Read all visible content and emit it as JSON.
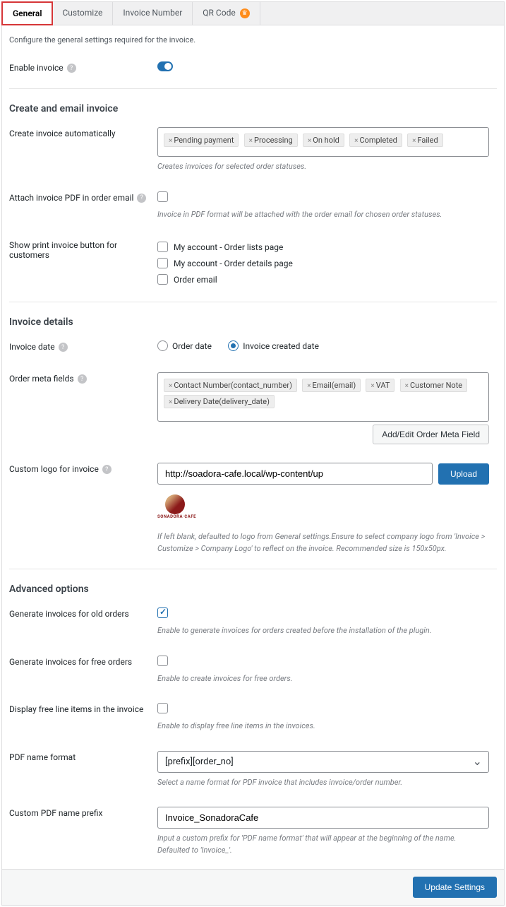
{
  "tabs": {
    "general": "General",
    "customize": "Customize",
    "invoice_number": "Invoice Number",
    "qr_code": "QR Code"
  },
  "intro": "Configure the general settings required for the invoice.",
  "enable": {
    "label": "Enable invoice"
  },
  "section_create": "Create and email invoice",
  "auto": {
    "label": "Create invoice automatically",
    "tags": [
      "Pending payment",
      "Processing",
      "On hold",
      "Completed",
      "Failed"
    ],
    "desc": "Creates invoices for selected order statuses."
  },
  "attach": {
    "label": "Attach invoice PDF in order email",
    "desc": "Invoice in PDF format will be attached with the order email for chosen order statuses."
  },
  "print": {
    "label": "Show print invoice button for customers",
    "opts": [
      "My account - Order lists page",
      "My account - Order details page",
      "Order email"
    ]
  },
  "section_details": "Invoice details",
  "date": {
    "label": "Invoice date",
    "opt1": "Order date",
    "opt2": "Invoice created date"
  },
  "meta": {
    "label": "Order meta fields",
    "tags": [
      "Contact Number(contact_number)",
      "Email(email)",
      "VAT",
      "Customer Note",
      "Delivery Date(delivery_date)"
    ],
    "btn": "Add/Edit Order Meta Field"
  },
  "logo": {
    "label": "Custom logo for invoice",
    "url": "http://soadora-cafe.local/wp-content/up",
    "upload": "Upload",
    "brand": "SONADORA·CAFE",
    "desc": "If left blank, defaulted to logo from General settings.Ensure to select company logo from 'Invoice > Customize > Company Logo' to reflect on the invoice. Recommended size is 150x50px."
  },
  "section_advanced": "Advanced options",
  "old": {
    "label": "Generate invoices for old orders",
    "desc": "Enable to generate invoices for orders created before the installation of the plugin."
  },
  "free": {
    "label": "Generate invoices for free orders",
    "desc": "Enable to create invoices for free orders."
  },
  "free_line": {
    "label": "Display free line items in the invoice",
    "desc": "Enable to display free line items in the invoices."
  },
  "pdf_format": {
    "label": "PDF name format",
    "value": "[prefix][order_no]",
    "desc": "Select a name format for PDF invoice that includes invoice/order number."
  },
  "pdf_prefix": {
    "label": "Custom PDF name prefix",
    "value": "Invoice_SonadoraCafe",
    "desc": "Input a custom prefix for 'PDF name format' that will appear at the beginning of the name. Defaulted to 'Invoice_'."
  },
  "update": "Update Settings"
}
